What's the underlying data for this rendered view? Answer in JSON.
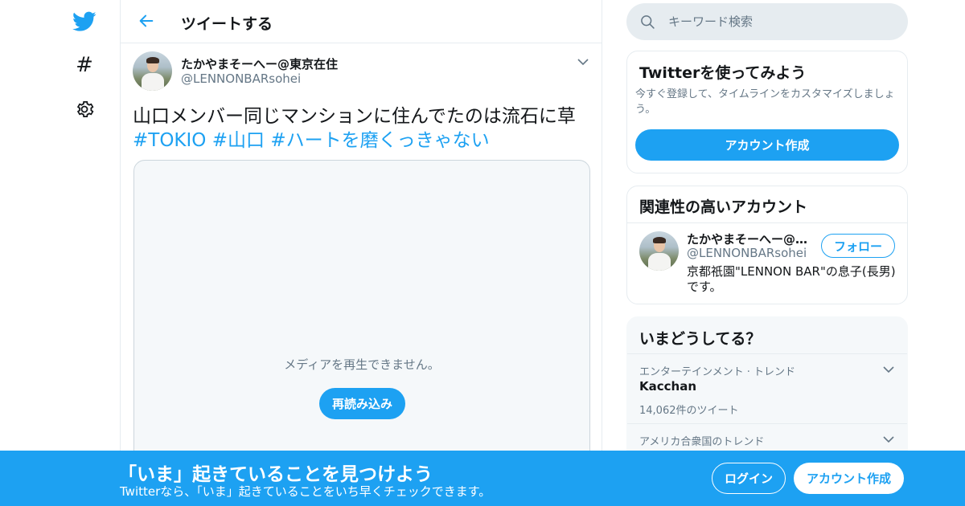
{
  "colors": {
    "accent": "#1da1f2",
    "text": "#14171a",
    "secondary": "#657786",
    "border": "#e6ecf0"
  },
  "nav": {
    "icons": [
      "twitter-bird-icon",
      "hashtag-icon",
      "gear-icon"
    ],
    "hash_glyph": "#"
  },
  "header": {
    "title": "ツイートする"
  },
  "tweet": {
    "author_name": "たかやまそーへー@東京在住",
    "author_handle": "@LENNONBARsohei",
    "text": "山口メンバー同じマンションに住んでたのは流石に草",
    "hashtags": [
      "#TOKIO",
      "#山口",
      "#ハートを磨くっきゃない"
    ],
    "media_message": "メディアを再生できません。",
    "reload_label": "再読み込み"
  },
  "search": {
    "placeholder": "キーワード検索"
  },
  "signup_card": {
    "title": "Twitterを使ってみよう",
    "description": "今すぐ登録して、タイムラインをカスタマイズしましょう。",
    "button": "アカウント作成"
  },
  "related_card": {
    "title": "関連性の高いアカウント",
    "name": "たかやまそーへー@東京在住",
    "handle": "@LENNONBARsohei",
    "bio": "京都祇園\"LENNON BAR\"の息子(長男)です。",
    "follow": "フォロー"
  },
  "trends_card": {
    "title": "いまどうしてる？",
    "items": [
      {
        "category": "エンターテインメント · トレンド",
        "name": "Kacchan",
        "count": "14,062件のツイート"
      },
      {
        "category": "アメリカ合衆国のトレンド",
        "name": "",
        "count": ""
      }
    ]
  },
  "banner": {
    "title": "「いま」起きていることを見つけよう",
    "subtitle": "Twitterなら、「いま」起きていることをいち早くチェックできます。",
    "login": "ログイン",
    "create": "アカウント作成"
  }
}
